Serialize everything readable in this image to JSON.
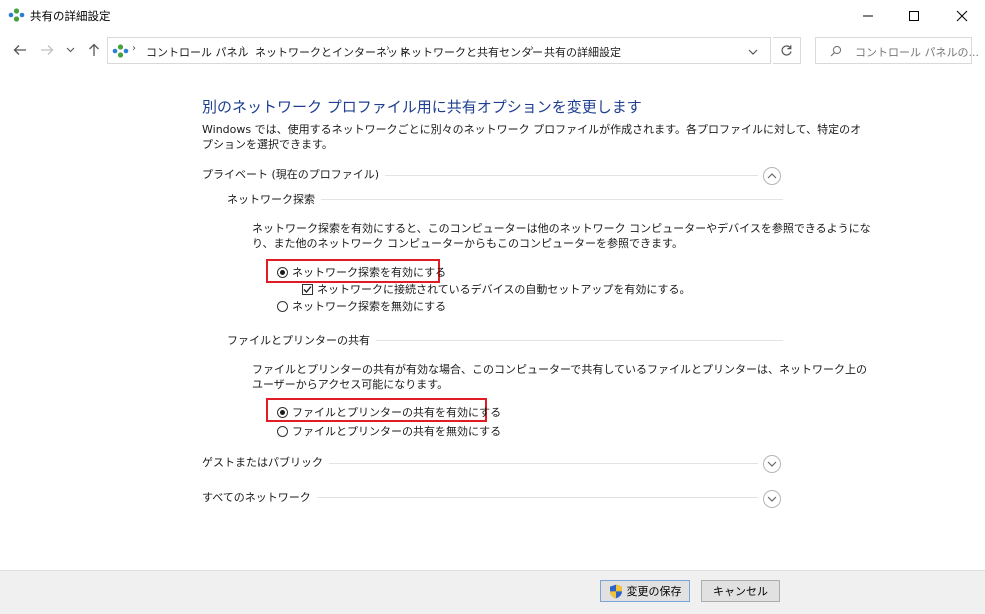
{
  "window": {
    "title": "共有の詳細設定",
    "minimize_label": "",
    "maximize_label": "",
    "close_label": ""
  },
  "address": {
    "crumbs": [
      "コントロール パネル",
      "ネットワークとインターネット",
      "ネットワークと共有センター",
      "共有の詳細設定"
    ],
    "search_placeholder": "コントロール パネルの..."
  },
  "content": {
    "heading": "別のネットワーク プロファイル用に共有オプションを変更します",
    "intro_line1": "Windows では、使用するネットワークごとに別々のネットワーク プロファイルが作成されます。各プロファイルに対して、特定のオ",
    "intro_line2": "プションを選択できます。",
    "private": {
      "title": "プライベート (現在のプロファイル)",
      "discovery": {
        "title": "ネットワーク探索",
        "desc_line1": "ネットワーク探索を有効にすると、このコンピューターは他のネットワーク コンピューターやデバイスを参照できるようにな",
        "desc_line2": "り、また他のネットワーク コンピューターからもこのコンピューターを参照できます。",
        "option_on": "ネットワーク探索を有効にする",
        "auto_setup": "ネットワークに接続されているデバイスの自動セットアップを有効にする。",
        "option_off": "ネットワーク探索を無効にする"
      },
      "sharing": {
        "title": "ファイルとプリンターの共有",
        "desc_line1": "ファイルとプリンターの共有が有効な場合、このコンピューターで共有しているファイルとプリンターは、ネットワーク上の",
        "desc_line2": "ユーザーからアクセス可能になります。",
        "option_on": "ファイルとプリンターの共有を有効にする",
        "option_off": "ファイルとプリンターの共有を無効にする"
      }
    },
    "guest_title": "ゲストまたはパブリック",
    "all_title": "すべてのネットワーク"
  },
  "footer": {
    "save_label": "変更の保存",
    "cancel_label": "キャンセル"
  },
  "colors": {
    "heading": "#1e3f8f",
    "highlight": "#e01c24",
    "footer_bg": "#f0f0f0"
  }
}
